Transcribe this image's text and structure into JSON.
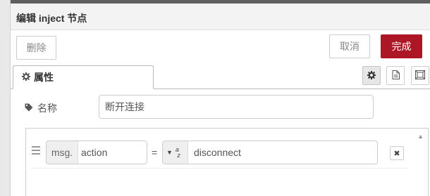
{
  "dialog": {
    "title": "编辑 inject 节点"
  },
  "actions": {
    "delete_label": "删除",
    "cancel_label": "取消",
    "done_label": "完成",
    "accent_color": "#ad1625"
  },
  "tabs": {
    "properties_label": "属性",
    "icons": [
      "gear-icon",
      "document-icon",
      "frame-icon"
    ]
  },
  "form": {
    "name_label": "名称",
    "name_value": "断开连接"
  },
  "props_list": {
    "rows": [
      {
        "prefix": "msg.",
        "property": "action",
        "operator": "=",
        "type_icon": "az",
        "value": "disconnect"
      }
    ]
  }
}
